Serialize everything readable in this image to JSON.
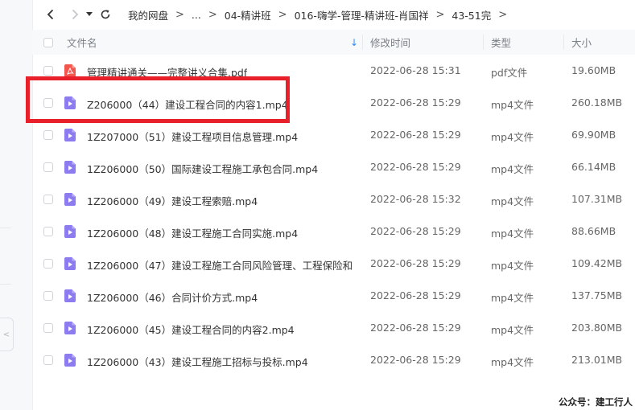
{
  "breadcrumb": {
    "items": [
      "我的网盘",
      "...",
      "04-精讲班",
      "016-嗨学-管理-精讲班-肖国祥",
      "43-51完"
    ],
    "separator": ">"
  },
  "columns": {
    "name": "文件名",
    "modified": "修改时间",
    "type": "类型",
    "size": "大小"
  },
  "sort_indicator": "↓",
  "sidebar": {
    "pill_label": "<"
  },
  "files": [
    {
      "name": "管理精讲通关——完整讲义合集.pdf",
      "modified": "2022-06-28 15:31",
      "type": "pdf文件",
      "size": "19.60MB",
      "icon": "pdf-icon"
    },
    {
      "name": "Z206000（44）建设工程合同的内容1.mp4",
      "modified": "2022-06-28 15:29",
      "type": "mp4文件",
      "size": "260.18MB",
      "icon": "video-icon"
    },
    {
      "name": "1Z207000（51）建设工程项目信息管理.mp4",
      "modified": "2022-06-28 15:29",
      "type": "mp4文件",
      "size": "69.90MB",
      "icon": "video-icon"
    },
    {
      "name": "1Z206000（50）国际建设工程施工承包合同.mp4",
      "modified": "2022-06-28 15:29",
      "type": "mp4文件",
      "size": "66.14MB",
      "icon": "video-icon"
    },
    {
      "name": "1Z206000（49）建设工程索赔.mp4",
      "modified": "2022-06-28 15:32",
      "type": "mp4文件",
      "size": "107.31MB",
      "icon": "video-icon"
    },
    {
      "name": "1Z206000（48）建设工程施工合同实施.mp4",
      "modified": "2022-06-28 15:29",
      "type": "mp4文件",
      "size": "88.66MB",
      "icon": "video-icon"
    },
    {
      "name": "1Z206000（47）建设工程施工合同风险管理、工程保险和...",
      "modified": "2022-06-28 15:29",
      "type": "mp4文件",
      "size": "109.42MB",
      "icon": "video-icon"
    },
    {
      "name": "1Z206000（46）合同计价方式.mp4",
      "modified": "2022-06-28 15:29",
      "type": "mp4文件",
      "size": "137.75MB",
      "icon": "video-icon"
    },
    {
      "name": "1Z206000（45）建设工程合同的内容2.mp4",
      "modified": "2022-06-28 15:29",
      "type": "mp4文件",
      "size": "203.80MB",
      "icon": "video-icon"
    },
    {
      "name": "1Z206000（43）建设工程施工招标与投标.mp4",
      "modified": "2022-06-28 15:29",
      "type": "mp4文件",
      "size": "213.01MB",
      "icon": "video-icon"
    }
  ],
  "watermark": "公众号：建工行人",
  "colors": {
    "pdf": "#f2564d",
    "video": "#8c7cf0",
    "highlight": "#e8202a",
    "sort_arrow": "#2f8cf6"
  }
}
